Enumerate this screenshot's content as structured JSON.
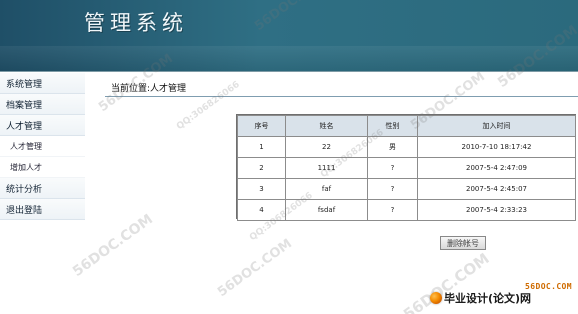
{
  "header": {
    "title": "管理系统"
  },
  "sidebar": {
    "items": [
      {
        "label": "系统管理",
        "type": "main"
      },
      {
        "label": "档案管理",
        "type": "main"
      },
      {
        "label": "人才管理",
        "type": "main"
      },
      {
        "label": "人才管理",
        "type": "sub"
      },
      {
        "label": "增加人才",
        "type": "sub"
      },
      {
        "label": "统计分析",
        "type": "main"
      },
      {
        "label": "退出登陆",
        "type": "main"
      }
    ]
  },
  "main": {
    "breadcrumb": "当前位置:人才管理",
    "table": {
      "headers": [
        "序号",
        "姓名",
        "性别",
        "加入时间"
      ],
      "rows": [
        {
          "id": "1",
          "name": "22",
          "gender": "男",
          "joined": "2010-7-10 18:17:42"
        },
        {
          "id": "2",
          "name": "1111",
          "gender": "?",
          "joined": "2007-5-4 2:47:09"
        },
        {
          "id": "3",
          "name": "faf",
          "gender": "?",
          "joined": "2007-5-4 2:45:07"
        },
        {
          "id": "4",
          "name": "fsdaf",
          "gender": "?",
          "joined": "2007-5-4 2:33:23"
        }
      ]
    },
    "delete_label": "删除帐号"
  },
  "brand": {
    "site": "56DOC.COM",
    "text": "毕业设计(论文)网"
  },
  "watermarks": [
    "56DOC.COM",
    "QQ:306826066"
  ]
}
